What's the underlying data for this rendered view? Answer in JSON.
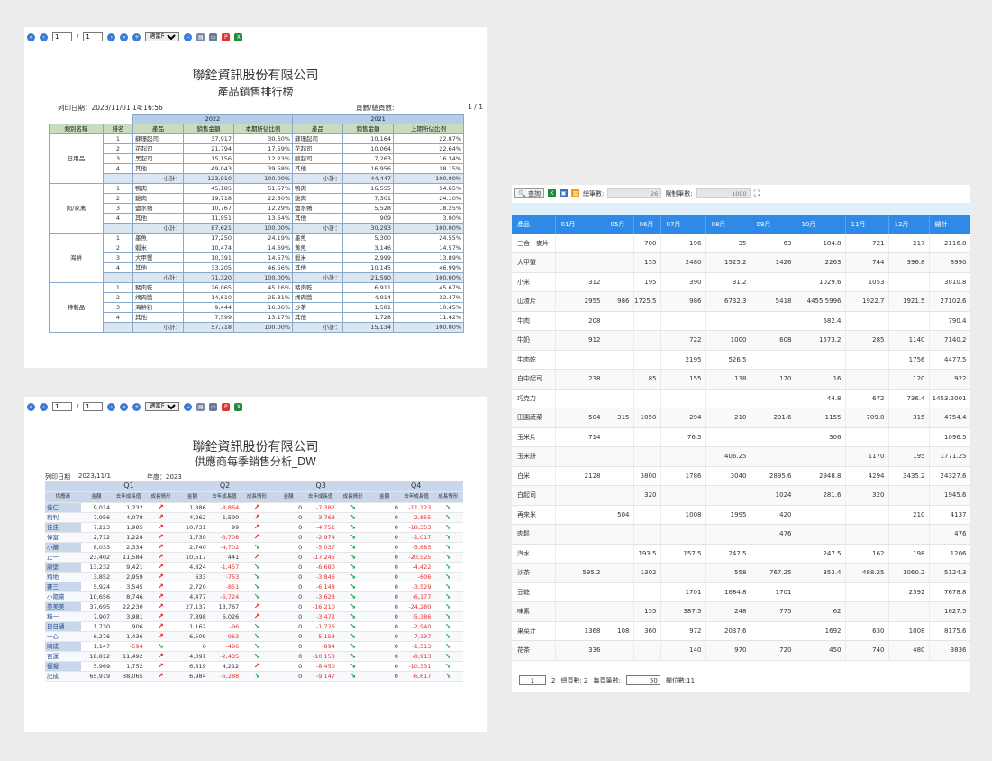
{
  "colors": {
    "accent": "#3a7bd5",
    "header_blue": "#2e8ae6",
    "up": "#e02020",
    "down": "#18a050"
  },
  "tb": {
    "page": "1",
    "total": "1",
    "zoom": "適當尺寸"
  },
  "r1": {
    "company": "聯銓資訊股份有限公司",
    "title": "產品銷售排行榜",
    "print": "列印日期：2023/11/01 14:16:56",
    "pglabel": "頁數/總頁數:",
    "pgval": "1 / 1",
    "year_a": "2022",
    "year_b": "2021",
    "cols": [
      "類別名稱",
      "排名",
      "產品",
      "銷售金額",
      "本期所佔比例",
      "產品",
      "銷售金額",
      "上期所佔比例"
    ],
    "cats": [
      {
        "name": "日用品",
        "rows": [
          [
            "1",
            "蘇珊起司",
            "37,917",
            "30.60%",
            "蘇珊起司",
            "10,164",
            "22.87%"
          ],
          [
            "2",
            "花起司",
            "21,794",
            "17.59%",
            "花起司",
            "10,064",
            "22.64%"
          ],
          [
            "3",
            "黑起司",
            "15,156",
            "12.23%",
            "酸起司",
            "7,263",
            "16.34%"
          ],
          [
            "4",
            "其他",
            "49,043",
            "39.58%",
            "其他",
            "16,956",
            "38.15%"
          ]
        ],
        "sub": [
          "小計：",
          "123,910",
          "100.00%",
          "小計：",
          "44,447",
          "100.00%"
        ]
      },
      {
        "name": "肉/家禽",
        "rows": [
          [
            "1",
            "鴨肉",
            "45,185",
            "51.57%",
            "鴨肉",
            "16,555",
            "54.65%"
          ],
          [
            "2",
            "雞肉",
            "19,718",
            "22.50%",
            "雞肉",
            "7,301",
            "24.10%"
          ],
          [
            "3",
            "鹽水鴨",
            "10,767",
            "12.29%",
            "鹽水鴨",
            "5,528",
            "18.25%"
          ],
          [
            "4",
            "其他",
            "11,951",
            "13.64%",
            "其他",
            "909",
            "3.00%"
          ]
        ],
        "sub": [
          "小計：",
          "87,621",
          "100.00%",
          "小計：",
          "30,293",
          "100.00%"
        ]
      },
      {
        "name": "海鮮",
        "rows": [
          [
            "1",
            "墨魚",
            "17,250",
            "24.19%",
            "墨魚",
            "5,300",
            "24.55%"
          ],
          [
            "2",
            "蝦米",
            "10,474",
            "14.69%",
            "黃魚",
            "3,146",
            "14.57%"
          ],
          [
            "3",
            "大甲蟹",
            "10,391",
            "14.57%",
            "蝦米",
            "2,999",
            "13.89%"
          ],
          [
            "4",
            "其他",
            "33,205",
            "46.56%",
            "其他",
            "10,145",
            "46.99%"
          ]
        ],
        "sub": [
          "小計：",
          "71,320",
          "100.00%",
          "小計：",
          "21,590",
          "100.00%"
        ]
      },
      {
        "name": "特製品",
        "rows": [
          [
            "1",
            "豬肉乾",
            "26,065",
            "45.16%",
            "豬肉乾",
            "6,911",
            "45.67%"
          ],
          [
            "2",
            "烤肉醬",
            "14,610",
            "25.31%",
            "烤肉醬",
            "4,914",
            "32.47%"
          ],
          [
            "3",
            "海鮮粉",
            "9,444",
            "16.36%",
            "沙茶",
            "1,581",
            "10.45%"
          ],
          [
            "4",
            "其他",
            "7,599",
            "13.17%",
            "其他",
            "1,728",
            "11.42%"
          ]
        ],
        "sub": [
          "小計：",
          "57,718",
          "100.00%",
          "小計：",
          "15,134",
          "100.00%"
        ]
      }
    ]
  },
  "r2": {
    "company": "聯銓資訊股份有限公司",
    "title": "供應商每季銷售分析_DW",
    "print_label": "列印日期",
    "print_date": "2023/11/1",
    "year_label": "年度：2023",
    "quarters": [
      "Q1",
      "Q2",
      "Q3",
      "Q4"
    ],
    "cols": [
      "供應商",
      "金額",
      "去年成長值",
      "成長情形",
      "金額",
      "去年成長值",
      "成長情形",
      "金額",
      "去年成長值",
      "成長情形",
      "金額",
      "去年成長值",
      "成長情形"
    ],
    "rows": [
      [
        "佳仁",
        "9,014",
        "1,232",
        "up",
        "1,886",
        "-8,864",
        "up",
        "0",
        "-7,382",
        "dn",
        "0",
        "-11,123",
        "dn"
      ],
      [
        "利利",
        "7,956",
        "4,078",
        "up",
        "4,262",
        "1,590",
        "up",
        "0",
        "-3,768",
        "dn",
        "0",
        "-2,855",
        "dn"
      ],
      [
        "佳佳",
        "7,223",
        "1,985",
        "up",
        "10,731",
        "99",
        "up",
        "0",
        "-4,751",
        "dn",
        "0",
        "-18,353",
        "dn"
      ],
      [
        "偉富",
        "2,712",
        "1,228",
        "up",
        "1,730",
        "-3,708",
        "up",
        "0",
        "-2,974",
        "dn",
        "0",
        "-1,017",
        "dn"
      ],
      [
        "小攤",
        "8,033",
        "2,334",
        "up",
        "2,740",
        "-4,702",
        "dn",
        "0",
        "-5,037",
        "dn",
        "0",
        "-5,685",
        "dn"
      ],
      [
        "正一",
        "23,402",
        "11,584",
        "up",
        "10,517",
        "441",
        "up",
        "0",
        "-17,245",
        "dn",
        "0",
        "-20,525",
        "dn"
      ],
      [
        "康堡",
        "13,232",
        "9,421",
        "up",
        "4,824",
        "-1,457",
        "dn",
        "0",
        "-6,680",
        "dn",
        "0",
        "-4,422",
        "dn"
      ],
      [
        "翔地",
        "3,852",
        "2,959",
        "up",
        "633",
        "-753",
        "dn",
        "0",
        "-3,846",
        "dn",
        "0",
        "-606",
        "dn"
      ],
      [
        "賽三",
        "5,924",
        "3,545",
        "up",
        "2,720",
        "-851",
        "dn",
        "0",
        "-6,148",
        "dn",
        "0",
        "-3,529",
        "dn"
      ],
      [
        "小陽黨",
        "10,656",
        "8,746",
        "up",
        "4,477",
        "-6,724",
        "dn",
        "0",
        "-3,628",
        "dn",
        "0",
        "-6,177",
        "dn"
      ],
      [
        "美美美",
        "37,695",
        "22,230",
        "up",
        "27,137",
        "13,767",
        "up",
        "0",
        "-16,210",
        "dn",
        "0",
        "-24,280",
        "dn"
      ],
      [
        "稱一",
        "7,907",
        "3,981",
        "up",
        "7,898",
        "6,026",
        "up",
        "0",
        "-3,472",
        "dn",
        "0",
        "-5,386",
        "dn"
      ],
      [
        "日日通",
        "1,730",
        "906",
        "up",
        "1,162",
        "-96",
        "dn",
        "0",
        "-1,726",
        "dn",
        "0",
        "-2,940",
        "dn"
      ],
      [
        "一心",
        "6,276",
        "1,436",
        "up",
        "6,509",
        "-963",
        "dn",
        "0",
        "-5,158",
        "dn",
        "0",
        "-7,137",
        "dn"
      ],
      [
        "順成",
        "1,147",
        "-594",
        "dn",
        "0",
        "-486",
        "dn",
        "0",
        "-894",
        "dn",
        "0",
        "-1,513",
        "dn"
      ],
      [
        "百運",
        "18,812",
        "11,492",
        "up",
        "4,391",
        "-2,435",
        "dn",
        "0",
        "-10,153",
        "dn",
        "0",
        "-8,913",
        "dn"
      ],
      [
        "優凝",
        "5,969",
        "1,752",
        "up",
        "6,319",
        "4,212",
        "up",
        "0",
        "-8,450",
        "dn",
        "0",
        "-10,331",
        "dn"
      ],
      [
        "記成",
        "65,919",
        "38,065",
        "up",
        "6,984",
        "-6,288",
        "dn",
        "0",
        "-9,147",
        "dn",
        "0",
        "-6,617",
        "dn"
      ]
    ]
  },
  "r3": {
    "query_btn": "查詢",
    "count_label": "總筆數:",
    "count_val": "26",
    "limit_label": "限制筆數:",
    "limit_val": "1000",
    "cols": [
      "產品",
      "01月",
      "05月",
      "06月",
      "07月",
      "08月",
      "09月",
      "10月",
      "11月",
      "12月",
      "總計"
    ],
    "rows": [
      [
        "三合一麥片",
        "",
        "",
        "700",
        "196",
        "35",
        "63",
        "184.8",
        "721",
        "217",
        "2116.8"
      ],
      [
        "大甲蟹",
        "",
        "",
        "155",
        "2480",
        "1525.2",
        "1426",
        "2263",
        "744",
        "396.8",
        "8990"
      ],
      [
        "小米",
        "312",
        "",
        "195",
        "390",
        "31.2",
        "",
        "1029.6",
        "1053",
        "",
        "3010.8"
      ],
      [
        "山渣片",
        "2955",
        "986",
        "1725.5",
        "986",
        "6732.3",
        "5418",
        "4455.5996",
        "1922.7",
        "1921.5",
        "27102.6"
      ],
      [
        "牛肉",
        "208",
        "",
        "",
        "",
        "",
        "",
        "582.4",
        "",
        "",
        "790.4"
      ],
      [
        "牛奶",
        "912",
        "",
        "",
        "722",
        "1000",
        "608",
        "1573.2",
        "285",
        "1140",
        "7140.2"
      ],
      [
        "牛肉乾",
        "",
        "",
        "",
        "2195",
        "526.5",
        "",
        "",
        "",
        "1756",
        "4477.5"
      ],
      [
        "白中起司",
        "238",
        "",
        "85",
        "155",
        "138",
        "170",
        "16",
        "",
        "120",
        "922"
      ],
      [
        "巧克力",
        "",
        "",
        "",
        "",
        "",
        "",
        "44.8",
        "672",
        "736.4",
        "1453.2001"
      ],
      [
        "田園蔬菜",
        "504",
        "315",
        "1050",
        "294",
        "210",
        "201.6",
        "1155",
        "709.8",
        "315",
        "4754.4"
      ],
      [
        "玉米片",
        "714",
        "",
        "",
        "76.5",
        "",
        "",
        "306",
        "",
        "",
        "1096.5"
      ],
      [
        "玉米餅",
        "",
        "",
        "",
        "",
        "406.25",
        "",
        "",
        "1170",
        "195",
        "1771.25"
      ],
      [
        "白米",
        "2128",
        "",
        "3800",
        "1786",
        "3040",
        "2895.6",
        "2948.8",
        "4294",
        "3435.2",
        "24327.6"
      ],
      [
        "白起司",
        "",
        "",
        "320",
        "",
        "",
        "1024",
        "281.6",
        "320",
        "",
        "1945.6"
      ],
      [
        "再來米",
        "",
        "504",
        "",
        "1008",
        "1995",
        "420",
        "",
        "",
        "210",
        "4137"
      ],
      [
        "肉鬆",
        "",
        "",
        "",
        "",
        "",
        "476",
        "",
        "",
        "",
        "476"
      ],
      [
        "汽水",
        "",
        "",
        "193.5",
        "157.5",
        "247.5",
        "",
        "247.5",
        "162",
        "198",
        "1206"
      ],
      [
        "沙茶",
        "595.2",
        "",
        "1302",
        "",
        "558",
        "767.25",
        "353.4",
        "488.25",
        "1060.2",
        "5124.3"
      ],
      [
        "豆乾",
        "",
        "",
        "",
        "1701",
        "1684.8",
        "1701",
        "",
        "",
        "2592",
        "7678.8"
      ],
      [
        "味素",
        "",
        "",
        "155",
        "387.5",
        "248",
        "775",
        "62",
        "",
        "",
        "1627.5"
      ],
      [
        "果菜汁",
        "1368",
        "108",
        "360",
        "972",
        "2037.6",
        "",
        "1692",
        "630",
        "1008",
        "8175.6"
      ],
      [
        "花茶",
        "336",
        "",
        "",
        "140",
        "970",
        "720",
        "450",
        "740",
        "480",
        "3836"
      ]
    ],
    "pager": {
      "page": "1",
      "p2": "2",
      "total_pages": "總頁數: 2",
      "per_page_label": "每頁筆數:",
      "per_page": "50",
      "fields": "欄位數:11"
    }
  }
}
